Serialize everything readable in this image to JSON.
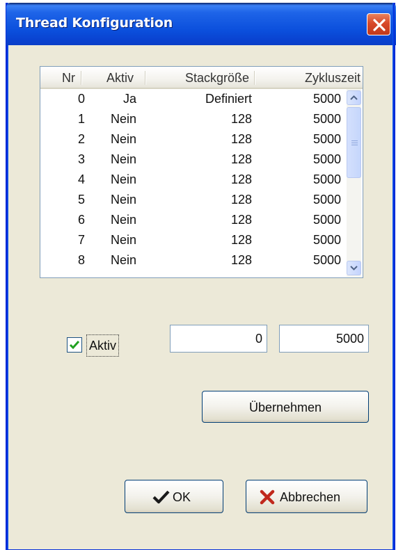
{
  "window": {
    "title": "Thread Konfiguration",
    "close_icon": "close-x-icon"
  },
  "list": {
    "headers": [
      "Nr",
      "Aktiv",
      "Stackgröße",
      "Zykluszeit"
    ],
    "rows": [
      {
        "nr": "0",
        "aktiv": "Ja",
        "stack": "Definiert",
        "zyklus": "5000"
      },
      {
        "nr": "1",
        "aktiv": "Nein",
        "stack": "128",
        "zyklus": "5000"
      },
      {
        "nr": "2",
        "aktiv": "Nein",
        "stack": "128",
        "zyklus": "5000"
      },
      {
        "nr": "3",
        "aktiv": "Nein",
        "stack": "128",
        "zyklus": "5000"
      },
      {
        "nr": "4",
        "aktiv": "Nein",
        "stack": "128",
        "zyklus": "5000"
      },
      {
        "nr": "5",
        "aktiv": "Nein",
        "stack": "128",
        "zyklus": "5000"
      },
      {
        "nr": "6",
        "aktiv": "Nein",
        "stack": "128",
        "zyklus": "5000"
      },
      {
        "nr": "7",
        "aktiv": "Nein",
        "stack": "128",
        "zyklus": "5000"
      },
      {
        "nr": "8",
        "aktiv": "Nein",
        "stack": "128",
        "zyklus": "5000"
      }
    ]
  },
  "form": {
    "aktiv_label": "Aktiv",
    "aktiv_checked": true,
    "stack_value": "0",
    "zyklus_value": "5000",
    "apply_label": "Übernehmen"
  },
  "buttons": {
    "ok_label": "OK",
    "cancel_label": "Abbrechen"
  },
  "colors": {
    "titlebar": "#0b4fdc",
    "dialog_bg": "#ece9d8",
    "close": "#d8492a",
    "ok_check": "#1a1a1a",
    "cancel_x": "#c0281c"
  }
}
